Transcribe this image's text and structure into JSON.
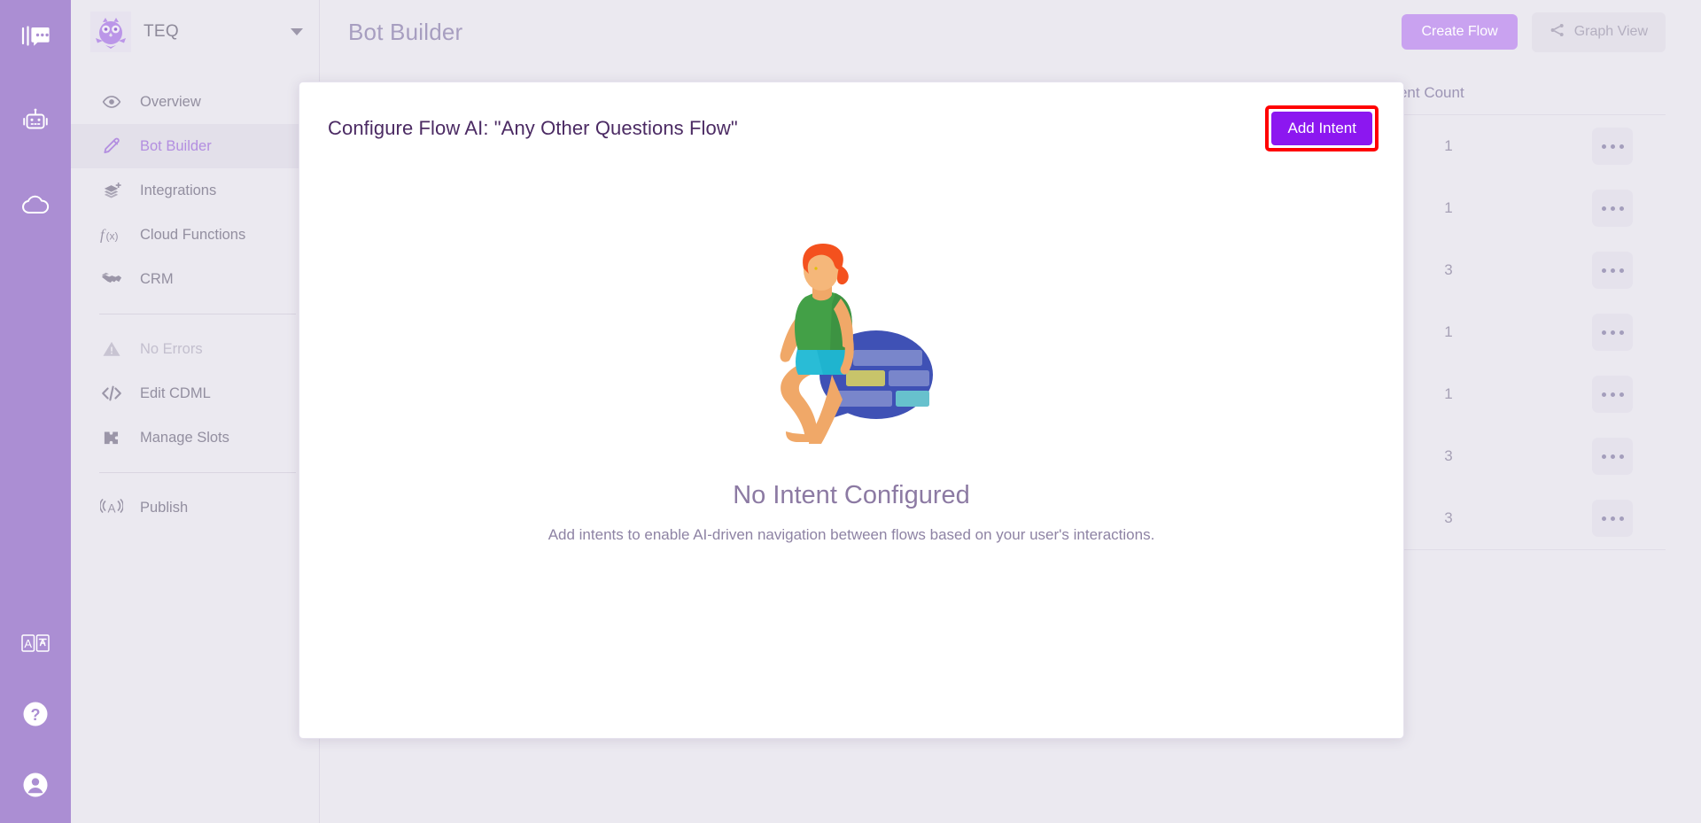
{
  "rail": {
    "top_icons": [
      {
        "name": "chat-logo-icon",
        "label": "Chat Logo"
      },
      {
        "name": "robot-icon",
        "label": "Bots"
      },
      {
        "name": "cloud-icon",
        "label": "Cloud"
      }
    ],
    "bottom_icons": [
      {
        "name": "translate-icon",
        "label": "Translate"
      },
      {
        "name": "help-icon",
        "label": "Help"
      },
      {
        "name": "account-icon",
        "label": "Account"
      }
    ]
  },
  "sidebar": {
    "brand": {
      "name": "TEQ",
      "logo_icon": "owl-logo-icon",
      "caret_icon": "chevron-down-icon"
    },
    "items": [
      {
        "label": "Overview",
        "icon": "eye-icon",
        "active": false,
        "disabled": false
      },
      {
        "label": "Bot Builder",
        "icon": "pencil-icon",
        "active": true,
        "disabled": false
      },
      {
        "label": "Integrations",
        "icon": "layers-plus-icon",
        "active": false,
        "disabled": false
      },
      {
        "label": "Cloud Functions",
        "icon": "function-icon",
        "active": false,
        "disabled": false
      },
      {
        "label": "CRM",
        "icon": "handshake-icon",
        "active": false,
        "disabled": false
      },
      {
        "label": "No Errors",
        "icon": "warning-icon",
        "active": false,
        "disabled": true
      },
      {
        "label": "Edit CDML",
        "icon": "code-icon",
        "active": false,
        "disabled": false
      },
      {
        "label": "Manage Slots",
        "icon": "puzzle-icon",
        "active": false,
        "disabled": false
      },
      {
        "label": "Publish",
        "icon": "broadcast-icon",
        "active": false,
        "disabled": false
      }
    ]
  },
  "header": {
    "title": "Bot Builder",
    "create_flow_label": "Create Flow",
    "graph_view_label": "Graph View",
    "graph_view_icon": "graph-node-icon"
  },
  "background_table": {
    "columns": [
      "low Element Count"
    ],
    "rows": [
      {
        "count": "1",
        "actions_icon": "ellipsis-icon"
      },
      {
        "count": "1",
        "actions_icon": "ellipsis-icon"
      },
      {
        "count": "3",
        "actions_icon": "ellipsis-icon"
      },
      {
        "count": "1",
        "actions_icon": "ellipsis-icon"
      },
      {
        "count": "1",
        "actions_icon": "ellipsis-icon"
      },
      {
        "count": "3",
        "actions_icon": "ellipsis-icon"
      },
      {
        "count": "3",
        "actions_icon": "ellipsis-icon"
      }
    ]
  },
  "modal": {
    "title": "Configure Flow AI: \"Any Other Questions Flow\"",
    "add_intent_label": "Add Intent",
    "empty_state": {
      "illustration": "person-sitting-on-chat-bubble-illustration",
      "title": "No Intent Configured",
      "subtitle": "Add intents to enable AI-driven navigation between flows based on your user's interactions."
    }
  },
  "colors": {
    "rail": "#ab8ed3",
    "page_background": "#ebe9f0",
    "accent_purple": "#b38ee0",
    "create_flow": "#c9a2f0",
    "add_intent": "#8c17f0",
    "highlight_border": "#ff0000",
    "modal_title": "#4b2a63"
  }
}
